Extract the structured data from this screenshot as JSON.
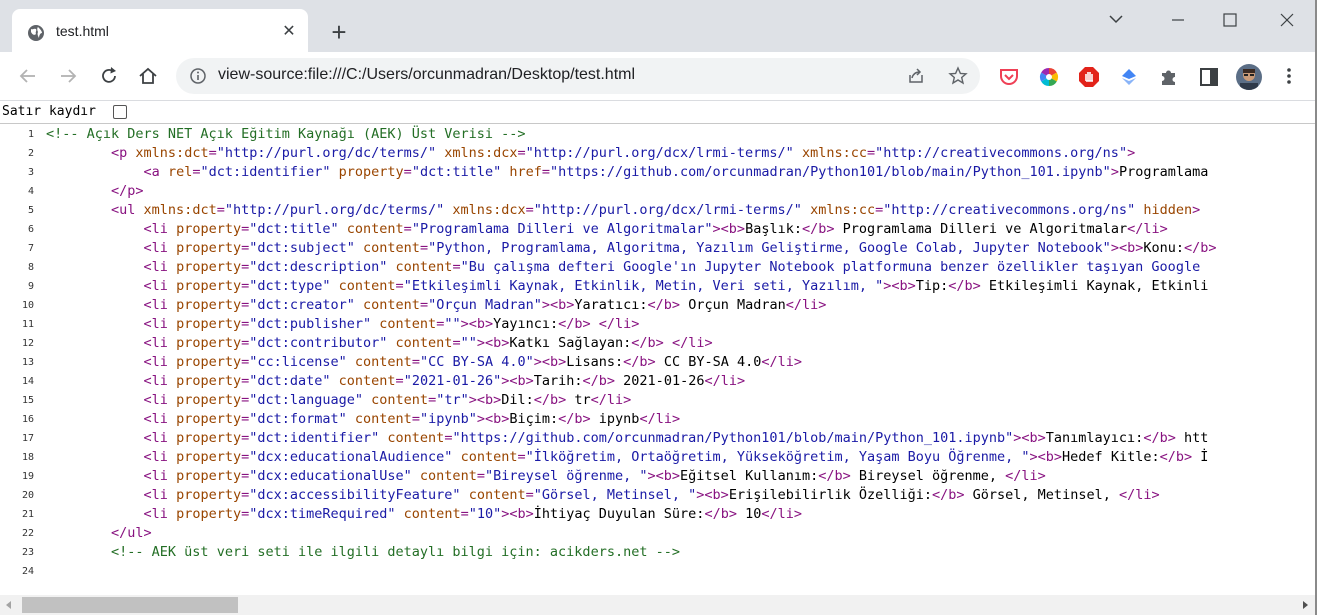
{
  "tab": {
    "title": "test.html",
    "close_symbol": "✕",
    "new_tab_symbol": "+"
  },
  "window": {
    "minimize": "minimize",
    "maximize": "maximize",
    "close": "close"
  },
  "omnibox": {
    "url": "view-source:file:///C:/Users/orcunmadran/Desktop/test.html"
  },
  "wrap": {
    "label": "Satır kaydır",
    "checked": false
  },
  "icons": [
    "globe-icon",
    "close-icon",
    "plus-icon",
    "chevron-down-icon",
    "minimize-icon",
    "maximize-icon",
    "close-icon",
    "back-arrow-icon",
    "forward-arrow-icon",
    "reload-icon",
    "home-icon",
    "info-icon",
    "share-icon",
    "star-icon",
    "pocket-icon",
    "color-wheel-icon",
    "adblock-icon",
    "drive-icon",
    "puzzle-icon",
    "side-panel-icon",
    "avatar-icon",
    "kebab-menu-icon"
  ],
  "colors": {
    "comment": "#236e25",
    "tag": "#881280",
    "attr_name": "#994500",
    "attr_value": "#1a1aa6",
    "tabstrip": "#dee1e6"
  },
  "source_lines": [
    {
      "n": "1",
      "parts": [
        [
          "cm",
          "<!-- Açık Ders NET Açık Eğitim Kaynağı (AEK) Üst Verisi -->"
        ]
      ]
    },
    {
      "n": "2",
      "parts": [
        [
          "tx",
          "        "
        ],
        [
          "tg",
          "<p "
        ],
        [
          "an",
          "xmlns:dct"
        ],
        [
          "tg",
          "="
        ],
        [
          "av",
          "\"http://purl.org/dc/terms/\""
        ],
        [
          "an",
          " xmlns:dcx"
        ],
        [
          "tg",
          "="
        ],
        [
          "av",
          "\"http://purl.org/dcx/lrmi-terms/\""
        ],
        [
          "an",
          " xmlns:cc"
        ],
        [
          "tg",
          "="
        ],
        [
          "av",
          "\"http://creativecommons.org/ns\""
        ],
        [
          "tg",
          ">"
        ]
      ]
    },
    {
      "n": "3",
      "parts": [
        [
          "tx",
          "            "
        ],
        [
          "tg",
          "<a "
        ],
        [
          "an",
          "rel"
        ],
        [
          "tg",
          "="
        ],
        [
          "av",
          "\"dct:identifier\""
        ],
        [
          "an",
          " property"
        ],
        [
          "tg",
          "="
        ],
        [
          "av",
          "\"dct:title\""
        ],
        [
          "an",
          " href"
        ],
        [
          "tg",
          "="
        ],
        [
          "av",
          "\"https://github.com/orcunmadran/Python101/blob/main/Python_101.ipynb\""
        ],
        [
          "tg",
          ">"
        ],
        [
          "tx",
          "Programlama"
        ]
      ]
    },
    {
      "n": "4",
      "parts": [
        [
          "tx",
          "        "
        ],
        [
          "tg",
          "</p>"
        ]
      ]
    },
    {
      "n": "5",
      "parts": [
        [
          "tx",
          "        "
        ],
        [
          "tg",
          "<ul "
        ],
        [
          "an",
          "xmlns:dct"
        ],
        [
          "tg",
          "="
        ],
        [
          "av",
          "\"http://purl.org/dc/terms/\""
        ],
        [
          "an",
          " xmlns:dcx"
        ],
        [
          "tg",
          "="
        ],
        [
          "av",
          "\"http://purl.org/dcx/lrmi-terms/\""
        ],
        [
          "an",
          " xmlns:cc"
        ],
        [
          "tg",
          "="
        ],
        [
          "av",
          "\"http://creativecommons.org/ns\""
        ],
        [
          "an",
          " hidden"
        ],
        [
          "tg",
          ">"
        ]
      ]
    },
    {
      "n": "6",
      "parts": [
        [
          "tx",
          "            "
        ],
        [
          "tg",
          "<li "
        ],
        [
          "an",
          "property"
        ],
        [
          "tg",
          "="
        ],
        [
          "av",
          "\"dct:title\""
        ],
        [
          "an",
          " content"
        ],
        [
          "tg",
          "="
        ],
        [
          "av",
          "\"Programlama Dilleri ve Algoritmalar\""
        ],
        [
          "tg",
          "><b>"
        ],
        [
          "tx",
          "Başlık:"
        ],
        [
          "tg",
          "</b>"
        ],
        [
          "tx",
          " Programlama Dilleri ve Algoritmalar"
        ],
        [
          "tg",
          "</li>"
        ]
      ]
    },
    {
      "n": "7",
      "parts": [
        [
          "tx",
          "            "
        ],
        [
          "tg",
          "<li "
        ],
        [
          "an",
          "property"
        ],
        [
          "tg",
          "="
        ],
        [
          "av",
          "\"dct:subject\""
        ],
        [
          "an",
          " content"
        ],
        [
          "tg",
          "="
        ],
        [
          "av",
          "\"Python, Programlama, Algoritma, Yazılım Geliştirme, Google Colab, Jupyter Notebook\""
        ],
        [
          "tg",
          "><b>"
        ],
        [
          "tx",
          "Konu:"
        ],
        [
          "tg",
          "</b>"
        ]
      ]
    },
    {
      "n": "8",
      "parts": [
        [
          "tx",
          "            "
        ],
        [
          "tg",
          "<li "
        ],
        [
          "an",
          "property"
        ],
        [
          "tg",
          "="
        ],
        [
          "av",
          "\"dct:description\""
        ],
        [
          "an",
          " content"
        ],
        [
          "tg",
          "="
        ],
        [
          "av",
          "\"Bu çalışma defteri Google'ın Jupyter Notebook platformuna benzer özellikler taşıyan Google"
        ]
      ]
    },
    {
      "n": "9",
      "parts": [
        [
          "tx",
          "            "
        ],
        [
          "tg",
          "<li "
        ],
        [
          "an",
          "property"
        ],
        [
          "tg",
          "="
        ],
        [
          "av",
          "\"dct:type\""
        ],
        [
          "an",
          " content"
        ],
        [
          "tg",
          "="
        ],
        [
          "av",
          "\"Etkileşimli Kaynak, Etkinlik, Metin, Veri seti, Yazılım, \""
        ],
        [
          "tg",
          "><b>"
        ],
        [
          "tx",
          "Tip:"
        ],
        [
          "tg",
          "</b>"
        ],
        [
          "tx",
          " Etkileşimli Kaynak, Etkinli"
        ]
      ]
    },
    {
      "n": "10",
      "parts": [
        [
          "tx",
          "            "
        ],
        [
          "tg",
          "<li "
        ],
        [
          "an",
          "property"
        ],
        [
          "tg",
          "="
        ],
        [
          "av",
          "\"dct:creator\""
        ],
        [
          "an",
          " content"
        ],
        [
          "tg",
          "="
        ],
        [
          "av",
          "\"Orçun Madran\""
        ],
        [
          "tg",
          "><b>"
        ],
        [
          "tx",
          "Yaratıcı:"
        ],
        [
          "tg",
          "</b>"
        ],
        [
          "tx",
          " Orçun Madran"
        ],
        [
          "tg",
          "</li>"
        ]
      ]
    },
    {
      "n": "11",
      "parts": [
        [
          "tx",
          "            "
        ],
        [
          "tg",
          "<li "
        ],
        [
          "an",
          "property"
        ],
        [
          "tg",
          "="
        ],
        [
          "av",
          "\"dct:publisher\""
        ],
        [
          "an",
          " content"
        ],
        [
          "tg",
          "="
        ],
        [
          "av",
          "\"\""
        ],
        [
          "tg",
          "><b>"
        ],
        [
          "tx",
          "Yayıncı:"
        ],
        [
          "tg",
          "</b>"
        ],
        [
          "tx",
          " "
        ],
        [
          "tg",
          "</li>"
        ]
      ]
    },
    {
      "n": "12",
      "parts": [
        [
          "tx",
          "            "
        ],
        [
          "tg",
          "<li "
        ],
        [
          "an",
          "property"
        ],
        [
          "tg",
          "="
        ],
        [
          "av",
          "\"dct:contributor\""
        ],
        [
          "an",
          " content"
        ],
        [
          "tg",
          "="
        ],
        [
          "av",
          "\"\""
        ],
        [
          "tg",
          "><b>"
        ],
        [
          "tx",
          "Katkı Sağlayan:"
        ],
        [
          "tg",
          "</b>"
        ],
        [
          "tx",
          " "
        ],
        [
          "tg",
          "</li>"
        ]
      ]
    },
    {
      "n": "13",
      "parts": [
        [
          "tx",
          "            "
        ],
        [
          "tg",
          "<li "
        ],
        [
          "an",
          "property"
        ],
        [
          "tg",
          "="
        ],
        [
          "av",
          "\"cc:license\""
        ],
        [
          "an",
          " content"
        ],
        [
          "tg",
          "="
        ],
        [
          "av",
          "\"CC BY-SA 4.0\""
        ],
        [
          "tg",
          "><b>"
        ],
        [
          "tx",
          "Lisans:"
        ],
        [
          "tg",
          "</b>"
        ],
        [
          "tx",
          " CC BY-SA 4.0"
        ],
        [
          "tg",
          "</li>"
        ]
      ]
    },
    {
      "n": "14",
      "parts": [
        [
          "tx",
          "            "
        ],
        [
          "tg",
          "<li "
        ],
        [
          "an",
          "property"
        ],
        [
          "tg",
          "="
        ],
        [
          "av",
          "\"dct:date\""
        ],
        [
          "an",
          " content"
        ],
        [
          "tg",
          "="
        ],
        [
          "av",
          "\"2021-01-26\""
        ],
        [
          "tg",
          "><b>"
        ],
        [
          "tx",
          "Tarih:"
        ],
        [
          "tg",
          "</b>"
        ],
        [
          "tx",
          " 2021-01-26"
        ],
        [
          "tg",
          "</li>"
        ]
      ]
    },
    {
      "n": "15",
      "parts": [
        [
          "tx",
          "            "
        ],
        [
          "tg",
          "<li "
        ],
        [
          "an",
          "property"
        ],
        [
          "tg",
          "="
        ],
        [
          "av",
          "\"dct:language\""
        ],
        [
          "an",
          " content"
        ],
        [
          "tg",
          "="
        ],
        [
          "av",
          "\"tr\""
        ],
        [
          "tg",
          "><b>"
        ],
        [
          "tx",
          "Dil:"
        ],
        [
          "tg",
          "</b>"
        ],
        [
          "tx",
          " tr"
        ],
        [
          "tg",
          "</li>"
        ]
      ]
    },
    {
      "n": "16",
      "parts": [
        [
          "tx",
          "            "
        ],
        [
          "tg",
          "<li "
        ],
        [
          "an",
          "property"
        ],
        [
          "tg",
          "="
        ],
        [
          "av",
          "\"dct:format\""
        ],
        [
          "an",
          " content"
        ],
        [
          "tg",
          "="
        ],
        [
          "av",
          "\"ipynb\""
        ],
        [
          "tg",
          "><b>"
        ],
        [
          "tx",
          "Biçim:"
        ],
        [
          "tg",
          "</b>"
        ],
        [
          "tx",
          " ipynb"
        ],
        [
          "tg",
          "</li>"
        ]
      ]
    },
    {
      "n": "17",
      "parts": [
        [
          "tx",
          "            "
        ],
        [
          "tg",
          "<li "
        ],
        [
          "an",
          "property"
        ],
        [
          "tg",
          "="
        ],
        [
          "av",
          "\"dct:identifier\""
        ],
        [
          "an",
          " content"
        ],
        [
          "tg",
          "="
        ],
        [
          "av",
          "\"https://github.com/orcunmadran/Python101/blob/main/Python_101.ipynb\""
        ],
        [
          "tg",
          "><b>"
        ],
        [
          "tx",
          "Tanımlayıcı:"
        ],
        [
          "tg",
          "</b>"
        ],
        [
          "tx",
          " htt"
        ]
      ]
    },
    {
      "n": "18",
      "parts": [
        [
          "tx",
          "            "
        ],
        [
          "tg",
          "<li "
        ],
        [
          "an",
          "property"
        ],
        [
          "tg",
          "="
        ],
        [
          "av",
          "\"dcx:educationalAudience\""
        ],
        [
          "an",
          " content"
        ],
        [
          "tg",
          "="
        ],
        [
          "av",
          "\"İlköğretim, Ortaöğretim, Yükseköğretim, Yaşam Boyu Öğrenme, \""
        ],
        [
          "tg",
          "><b>"
        ],
        [
          "tx",
          "Hedef Kitle:"
        ],
        [
          "tg",
          "</b>"
        ],
        [
          "tx",
          " İ"
        ]
      ]
    },
    {
      "n": "19",
      "parts": [
        [
          "tx",
          "            "
        ],
        [
          "tg",
          "<li "
        ],
        [
          "an",
          "property"
        ],
        [
          "tg",
          "="
        ],
        [
          "av",
          "\"dcx:educationalUse\""
        ],
        [
          "an",
          " content"
        ],
        [
          "tg",
          "="
        ],
        [
          "av",
          "\"Bireysel öğrenme, \""
        ],
        [
          "tg",
          "><b>"
        ],
        [
          "tx",
          "Eğitsel Kullanım:"
        ],
        [
          "tg",
          "</b>"
        ],
        [
          "tx",
          " Bireysel öğrenme, "
        ],
        [
          "tg",
          "</li>"
        ]
      ]
    },
    {
      "n": "20",
      "parts": [
        [
          "tx",
          "            "
        ],
        [
          "tg",
          "<li "
        ],
        [
          "an",
          "property"
        ],
        [
          "tg",
          "="
        ],
        [
          "av",
          "\"dcx:accessibilityFeature\""
        ],
        [
          "an",
          " content"
        ],
        [
          "tg",
          "="
        ],
        [
          "av",
          "\"Görsel, Metinsel, \""
        ],
        [
          "tg",
          "><b>"
        ],
        [
          "tx",
          "Erişilebilirlik Özelliği:"
        ],
        [
          "tg",
          "</b>"
        ],
        [
          "tx",
          " Görsel, Metinsel, "
        ],
        [
          "tg",
          "</li>"
        ]
      ]
    },
    {
      "n": "21",
      "parts": [
        [
          "tx",
          "            "
        ],
        [
          "tg",
          "<li "
        ],
        [
          "an",
          "property"
        ],
        [
          "tg",
          "="
        ],
        [
          "av",
          "\"dcx:timeRequired\""
        ],
        [
          "an",
          " content"
        ],
        [
          "tg",
          "="
        ],
        [
          "av",
          "\"10\""
        ],
        [
          "tg",
          "><b>"
        ],
        [
          "tx",
          "İhtiyaç Duyulan Süre:"
        ],
        [
          "tg",
          "</b>"
        ],
        [
          "tx",
          " 10"
        ],
        [
          "tg",
          "</li>"
        ]
      ]
    },
    {
      "n": "22",
      "parts": [
        [
          "tx",
          "        "
        ],
        [
          "tg",
          "</ul>"
        ]
      ]
    },
    {
      "n": "23",
      "parts": [
        [
          "tx",
          "        "
        ],
        [
          "cm",
          "<!-- AEK üst veri seti ile ilgili detaylı bilgi için: acikders.net -->"
        ]
      ]
    },
    {
      "n": "24",
      "parts": []
    }
  ]
}
